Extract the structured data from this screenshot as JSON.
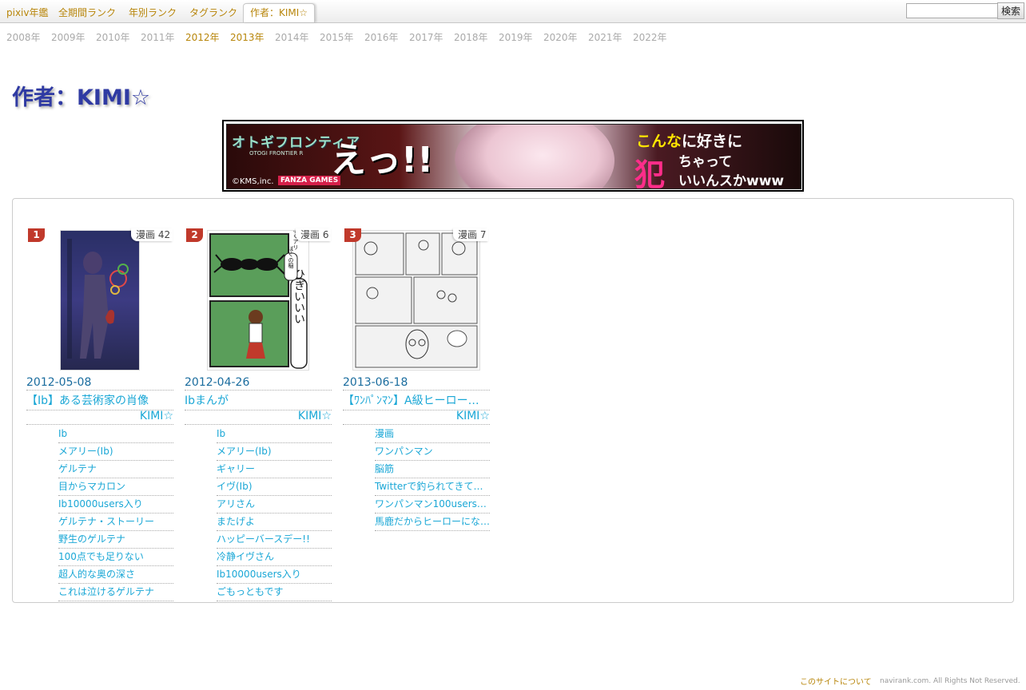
{
  "nav": {
    "tabs": [
      {
        "label": "pixiv年鑑"
      },
      {
        "label": "全期間ランク"
      },
      {
        "label": "年別ランク"
      },
      {
        "label": "タグランク"
      },
      {
        "label": "作者：KIMI☆"
      }
    ],
    "active_tab": 4,
    "search": {
      "value": "",
      "button_label": "検索"
    }
  },
  "years": [
    "2008年",
    "2009年",
    "2010年",
    "2011年",
    "2012年",
    "2013年",
    "2014年",
    "2015年",
    "2016年",
    "2017年",
    "2018年",
    "2019年",
    "2020年",
    "2021年",
    "2022年"
  ],
  "highlighted_years": [
    "2012年",
    "2013年"
  ],
  "page_title": "作者：KIMI☆",
  "banner": {
    "logo": "オトギフロンティア",
    "logo_sub": "OTOGI FRONTIER R",
    "exclaim": "えっ!!",
    "copyright": "©KMS,inc.",
    "brand": "FANZA GAMES",
    "line1_a": "こんな",
    "line1_b": "に好きに",
    "line2": "ちゃって",
    "line2_big": "犯",
    "line3": "いいんスかwww"
  },
  "works": [
    {
      "rank": "1",
      "category": "漫画 42",
      "date": "2012-05-08",
      "title": "【Ib】ある芸術家の肖像",
      "author": "KIMI☆",
      "tags": [
        "Ib",
        "メアリー(Ib)",
        "ゲルテナ",
        "目からマカロン",
        "Ib10000users入り",
        "ゲルテナ・ストーリー",
        "野生のゲルテナ",
        "100点でも足りない",
        "超人的な奥の深さ",
        "これは泣けるゲルテナ"
      ]
    },
    {
      "rank": "2",
      "category": "漫画 6",
      "date": "2012-04-26",
      "title": "Ibまんが",
      "author": "KIMI☆",
      "tags": [
        "Ib",
        "メアリー(Ib)",
        "ギャリー",
        "イヴ(Ib)",
        "アリさん",
        "またげよ",
        "ハッピーバースデー!!",
        "冷静イヴさん",
        "Ib10000users入り",
        "ごもっともです"
      ]
    },
    {
      "rank": "3",
      "category": "漫画 7",
      "date": "2013-06-18",
      "title": "【ﾜﾝﾊﾟﾝﾏﾝ】A級ヒーローと…",
      "author": "KIMI☆",
      "tags": [
        "漫画",
        "ワンパンマン",
        "脳筋",
        "Twitterで釣られてきてし…",
        "ワンパンマン100users…",
        "馬鹿だからヒーローにな…"
      ]
    }
  ],
  "thumb_texts": {
    "w2_bubble1": "ひぎいいい",
    "w2_bubble2": "ぼくの稲",
    "w2_bubble3": "なぐアリ"
  },
  "footer": {
    "about": "このサイトについて",
    "copyright": "navirank.com. All Rights Not Reserved."
  }
}
